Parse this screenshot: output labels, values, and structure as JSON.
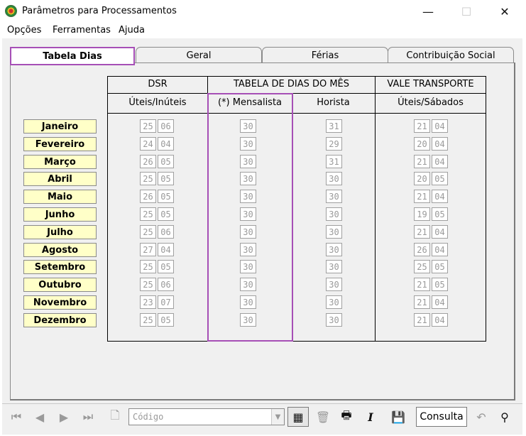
{
  "window": {
    "title": "Parâmetros para Processamentos",
    "minimize": "—",
    "maximize": "☐",
    "close": "✕"
  },
  "menu": [
    {
      "label": "Opções"
    },
    {
      "label": "Ferramentas"
    },
    {
      "label": "Ajuda"
    }
  ],
  "tabs": [
    {
      "label": "Tabela Dias",
      "active": true
    },
    {
      "label": "Geral"
    },
    {
      "label": "Férias"
    },
    {
      "label": "Contribuição Social"
    }
  ],
  "table": {
    "groups": {
      "dsr": "DSR",
      "tabela": "TABELA DE DIAS DO MÊS",
      "vale": "VALE TRANSPORTE"
    },
    "subheaders": {
      "dsr": "Úteis/Inúteis",
      "mensalista": "(*) Mensalista",
      "horista": "Horista",
      "vale": "Úteis/Sábados"
    },
    "rows": [
      {
        "month": "Janeiro",
        "dsr": [
          "25",
          "06"
        ],
        "mensalista": "30",
        "horista": "31",
        "vale": [
          "21",
          "04"
        ]
      },
      {
        "month": "Fevereiro",
        "dsr": [
          "24",
          "04"
        ],
        "mensalista": "30",
        "horista": "29",
        "vale": [
          "20",
          "04"
        ]
      },
      {
        "month": "Março",
        "dsr": [
          "26",
          "05"
        ],
        "mensalista": "30",
        "horista": "31",
        "vale": [
          "21",
          "04"
        ]
      },
      {
        "month": "Abril",
        "dsr": [
          "25",
          "05"
        ],
        "mensalista": "30",
        "horista": "30",
        "vale": [
          "20",
          "05"
        ]
      },
      {
        "month": "Maio",
        "dsr": [
          "26",
          "05"
        ],
        "mensalista": "30",
        "horista": "30",
        "vale": [
          "21",
          "04"
        ]
      },
      {
        "month": "Junho",
        "dsr": [
          "25",
          "05"
        ],
        "mensalista": "30",
        "horista": "30",
        "vale": [
          "19",
          "05"
        ]
      },
      {
        "month": "Julho",
        "dsr": [
          "25",
          "06"
        ],
        "mensalista": "30",
        "horista": "30",
        "vale": [
          "21",
          "04"
        ]
      },
      {
        "month": "Agosto",
        "dsr": [
          "27",
          "04"
        ],
        "mensalista": "30",
        "horista": "30",
        "vale": [
          "26",
          "04"
        ]
      },
      {
        "month": "Setembro",
        "dsr": [
          "25",
          "05"
        ],
        "mensalista": "30",
        "horista": "30",
        "vale": [
          "25",
          "05"
        ]
      },
      {
        "month": "Outubro",
        "dsr": [
          "25",
          "06"
        ],
        "mensalista": "30",
        "horista": "30",
        "vale": [
          "21",
          "05"
        ]
      },
      {
        "month": "Novembro",
        "dsr": [
          "23",
          "07"
        ],
        "mensalista": "30",
        "horista": "30",
        "vale": [
          "21",
          "04"
        ]
      },
      {
        "month": "Dezembro",
        "dsr": [
          "25",
          "05"
        ],
        "mensalista": "30",
        "horista": "30",
        "vale": [
          "21",
          "04"
        ]
      }
    ]
  },
  "toolbar": {
    "code_placeholder": "Código",
    "consulta_label": "Consulta",
    "icons": [
      "first-record-icon",
      "prev-record-icon",
      "next-record-icon",
      "last-record-icon",
      "new-document-icon",
      "code-combo",
      "select-table-icon",
      "delete-icon",
      "print-icon",
      "italic-icon",
      "save-icon",
      "consulta-button",
      "undo-icon",
      "binoculars-icon"
    ]
  },
  "colors": {
    "highlight": "#a64fb6",
    "month_bg": "#ffffc8",
    "panel_bg": "#f0f0f0"
  }
}
